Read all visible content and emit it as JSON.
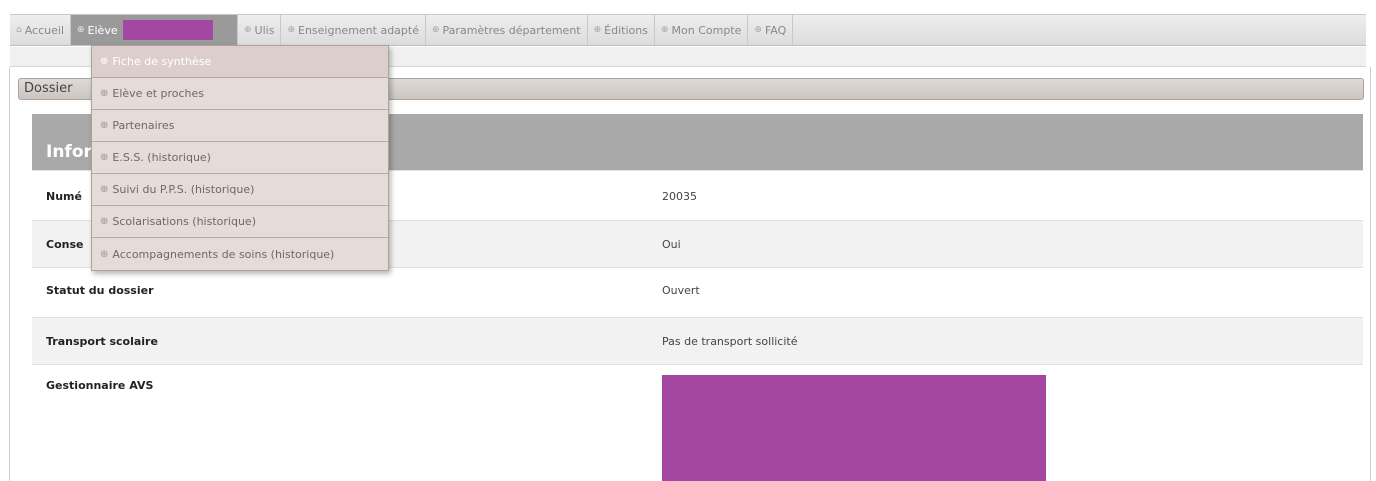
{
  "nav": {
    "items": [
      {
        "icon": "home-icon",
        "label": "Accueil"
      },
      {
        "icon": "circle-plus-icon",
        "label": "Elève"
      },
      {
        "icon": "circle-plus-icon",
        "label": "Ulis"
      },
      {
        "icon": "circle-plus-icon",
        "label": "Enseignement adapté"
      },
      {
        "icon": "circle-plus-icon",
        "label": "Paramètres département"
      },
      {
        "icon": "circle-plus-icon",
        "label": "Éditions"
      },
      {
        "icon": "circle-plus-icon",
        "label": "Mon Compte"
      },
      {
        "icon": "circle-plus-icon",
        "label": "FAQ"
      }
    ]
  },
  "dropdown": {
    "items": [
      {
        "label": "Fiche de synthèse"
      },
      {
        "label": "Elève et proches"
      },
      {
        "label": "Partenaires"
      },
      {
        "label": "E.S.S. (historique)"
      },
      {
        "label": "Suivi du P.P.S. (historique)"
      },
      {
        "label": "Scolarisations (historique)"
      },
      {
        "label": "Accompagnements de soins (historique)"
      }
    ]
  },
  "dossier": {
    "title": "Dossier"
  },
  "info": {
    "title": "Infor",
    "rows": [
      {
        "label": "Numé",
        "value": "20035"
      },
      {
        "label": "Conse",
        "value": "Oui"
      },
      {
        "label": "Statut du dossier",
        "value": "Ouvert"
      },
      {
        "label": "Transport scolaire",
        "value": "Pas de transport sollicité"
      },
      {
        "label": "Gestionnaire AVS",
        "value": ""
      }
    ]
  },
  "colors": {
    "redaction": "#a347a3",
    "panel_header": "#a9a9a9",
    "menu_bg": "#e5dbd8"
  }
}
